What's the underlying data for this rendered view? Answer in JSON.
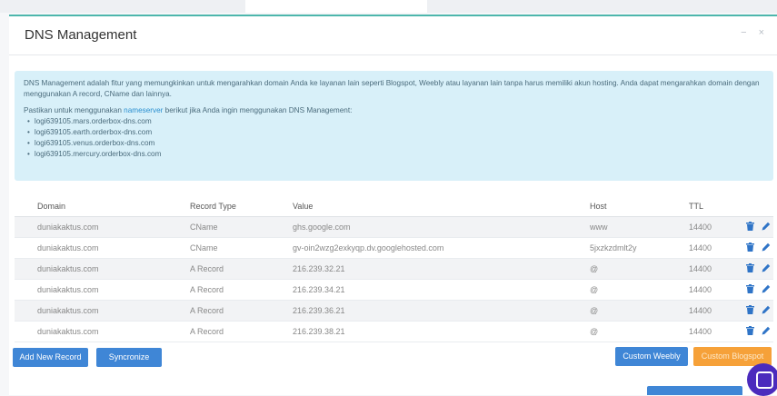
{
  "panel": {
    "title": "DNS Management",
    "collapse_glyph": "−",
    "close_glyph": "×"
  },
  "info": {
    "paragraph1": "DNS Management adalah fitur yang memungkinkan untuk mengarahkan domain Anda ke layanan lain seperti Blogspot, Weebly atau layanan lain tanpa harus memiliki akun hosting. Anda dapat mengarahkan domain dengan menggunakan A record, CName dan lainnya.",
    "p2_before": "Pastikan untuk menggunakan ",
    "p2_link": "nameserver",
    "p2_after": " berikut jika Anda ingin menggunakan DNS Management:",
    "nameservers": [
      "logi639105.mars.orderbox-dns.com",
      "logi639105.earth.orderbox-dns.com",
      "logi639105.venus.orderbox-dns.com",
      "logi639105.mercury.orderbox-dns.com"
    ]
  },
  "table": {
    "headers": {
      "domain": "Domain",
      "type": "Record Type",
      "value": "Value",
      "host": "Host",
      "ttl": "TTL"
    },
    "rows": [
      {
        "domain": "duniakaktus.com",
        "type": "CName",
        "value": "ghs.google.com",
        "host": "www",
        "ttl": "14400"
      },
      {
        "domain": "duniakaktus.com",
        "type": "CName",
        "value": "gv-oin2wzg2exkyqp.dv.googlehosted.com",
        "host": "5jxzkzdmlt2y",
        "ttl": "14400"
      },
      {
        "domain": "duniakaktus.com",
        "type": "A Record",
        "value": "216.239.32.21",
        "host": "@",
        "ttl": "14400"
      },
      {
        "domain": "duniakaktus.com",
        "type": "A Record",
        "value": "216.239.34.21",
        "host": "@",
        "ttl": "14400"
      },
      {
        "domain": "duniakaktus.com",
        "type": "A Record",
        "value": "216.239.36.21",
        "host": "@",
        "ttl": "14400"
      },
      {
        "domain": "duniakaktus.com",
        "type": "A Record",
        "value": "216.239.38.21",
        "host": "@",
        "ttl": "14400"
      }
    ]
  },
  "buttons": {
    "add_new_record": "Add New Record",
    "syncronize": "Syncronize",
    "custom_weebly": "Custom Weebly",
    "custom_blogspot": "Custom Blogspot"
  },
  "icons": {
    "delete": "trash-icon",
    "edit": "pencil-icon",
    "chat": "chat-icon"
  },
  "colors": {
    "accent": "#4db6ac",
    "info_bg": "#d8f0f9",
    "primary_button": "#3f86d6",
    "warning_button": "#f6a139",
    "chat_widget": "#4b2bbd"
  }
}
